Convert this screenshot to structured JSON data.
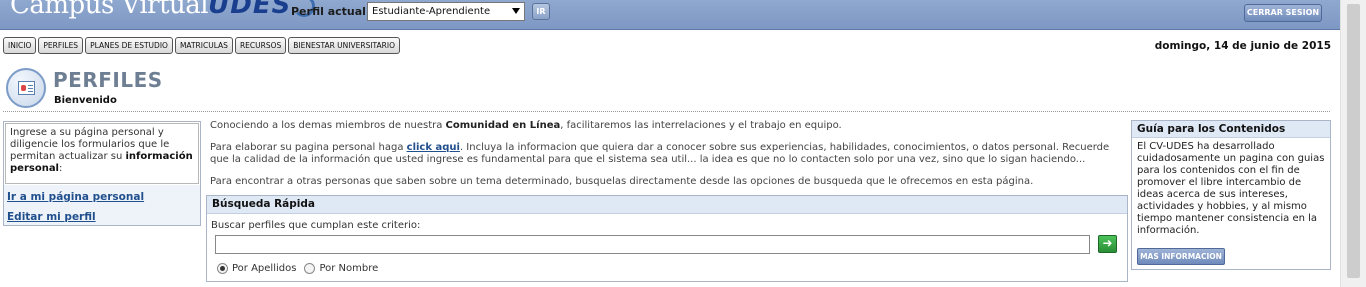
{
  "header": {
    "logo_text": "Campus Virtual",
    "logo_brand": "UDES",
    "perfil_label": "Perfil actual:",
    "perfil_selected": "Estudiante-Aprendiente",
    "ir_label": "IR",
    "logout_label": "CERRAR SESION"
  },
  "nav": {
    "items": [
      {
        "label": "INICIO"
      },
      {
        "label": "PERFILES"
      },
      {
        "label": "PLANES DE ESTUDIO"
      },
      {
        "label": "MATRICULAS"
      },
      {
        "label": "RECURSOS"
      },
      {
        "label": "BIENESTAR UNIVERSITARIO"
      }
    ],
    "date": "domingo, 14 de junio de 2015"
  },
  "page": {
    "title": "PERFILES",
    "subtitle": "Bienvenido"
  },
  "left_panel": {
    "intro_prefix": "Ingrese a su página personal y diligencie los formularios que le permitan actualizar su ",
    "intro_bold": "información personal",
    "intro_suffix": ":",
    "link_personal_page": "Ir a mi página personal",
    "link_edit_profile": "Editar mi perfil"
  },
  "main": {
    "p1_prefix": "Conociendo a los demas miembros de nuestra ",
    "p1_bold": "Comunidad en Línea",
    "p1_suffix": ", facilitaremos las interrelaciones y el trabajo en equipo.",
    "p2_prefix": "Para elaborar su pagina personal haga ",
    "p2_link": "click aqui",
    "p2_suffix": ". Incluya la informacion que quiera dar a conocer sobre sus experiencias, habilidades, conocimientos, o datos personal. Recuerde que la calidad de la información que usted ingrese es fundamental para que el sistema sea util... la idea es que no lo contacten solo por una vez, sino que lo sigan haciendo...",
    "p3": "Para encontrar a otras personas que saben sobre un tema determinado, busquelas directamente desde las opciones de busqueda que le ofrecemos en esta página."
  },
  "search": {
    "heading": "Búsqueda Rápida",
    "label": "Buscar perfiles que cumplan este criterio:",
    "value": "",
    "go_symbol": "➜",
    "option_surname": "Por Apellidos",
    "option_name": "Por Nombre",
    "selected": "Por Apellidos"
  },
  "guide": {
    "heading": "Guía para los Contenidos",
    "body": "El CV-UDES ha desarrollado cuidadosamente un pagina con guias para los contenidos con el fin de promover el libre intercambio de ideas acerca de sus intereses, actividades y hobbies, y al mismo tiempo mantener consistencia en la información.",
    "button": "MAS INFORMACION"
  },
  "colors": {
    "header_bar": "#8fa8cf",
    "link": "#1f4f8c",
    "panel_head": "#dfe8f5",
    "go_button": "#2a8e36"
  }
}
